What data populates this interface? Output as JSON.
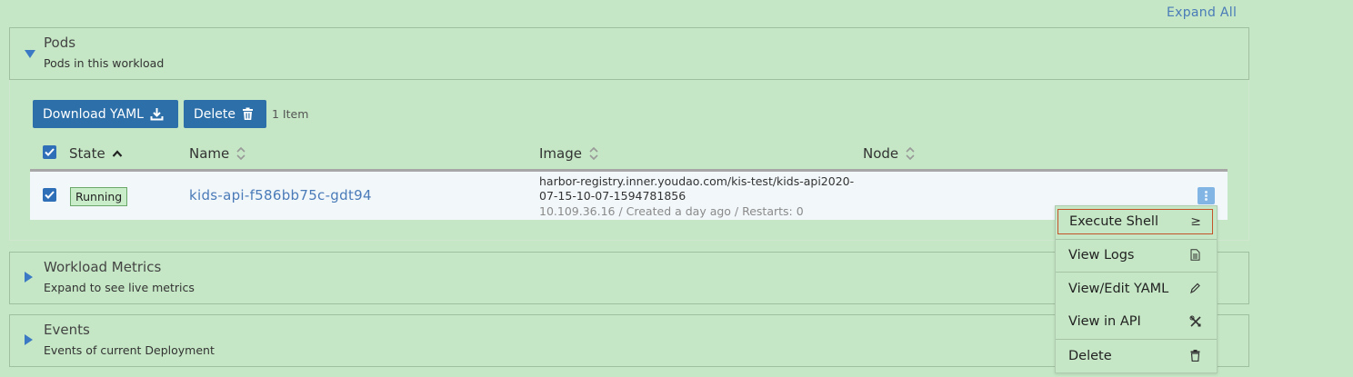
{
  "expand_all": "Expand All",
  "pods_section": {
    "title": "Pods",
    "subtitle": "Pods in this workload",
    "download_label": "Download YAML",
    "delete_label": "Delete",
    "item_count": "1 Item",
    "columns": {
      "state": "State",
      "name": "Name",
      "image": "Image",
      "node": "Node"
    },
    "row": {
      "state": "Running",
      "name": "kids-api-f586bb75c-gdt94",
      "image_line1": "harbor-registry.inner.youdao.com/kis-test/kids-api2020-",
      "image_line2": "07-15-10-07-1594781856",
      "meta": "10.109.36.16 / Created a day ago / Restarts: 0"
    }
  },
  "metrics_section": {
    "title": "Workload Metrics",
    "subtitle": "Expand to see live metrics"
  },
  "events_section": {
    "title": "Events",
    "subtitle": "Events of current Deployment"
  },
  "context_menu": {
    "items": [
      {
        "label": "Execute Shell",
        "icon": "≥"
      },
      {
        "label": "View Logs",
        "icon": "file-icon"
      },
      {
        "label": "View/Edit YAML",
        "icon": "pencil-icon"
      },
      {
        "label": "View in API",
        "icon": "tools-icon"
      },
      {
        "label": "Delete",
        "icon": "trash-icon"
      }
    ]
  },
  "colors": {
    "background": "#c5e7c5",
    "primary_button": "#2d6fa8",
    "link": "#4a7bb8",
    "active_border": "#c5532a"
  }
}
